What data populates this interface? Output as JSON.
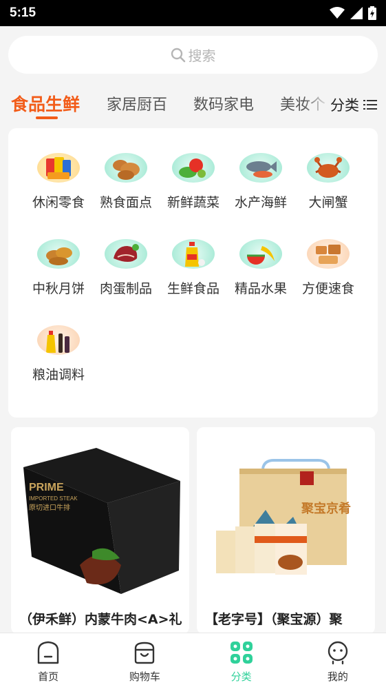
{
  "status_bar": {
    "time": "5:15"
  },
  "search": {
    "placeholder": "搜索"
  },
  "tabs": [
    {
      "label": "食品生鲜",
      "active": true
    },
    {
      "label": "家居厨百",
      "active": false
    },
    {
      "label": "数码家电",
      "active": false
    },
    {
      "label": "美妆个",
      "active": false
    }
  ],
  "category_toggle": {
    "label": "分类"
  },
  "categories": [
    {
      "label": "休闲零食",
      "icon": "snacks-icon"
    },
    {
      "label": "熟食面点",
      "icon": "bread-icon"
    },
    {
      "label": "新鲜蔬菜",
      "icon": "vegetables-icon"
    },
    {
      "label": "水产海鲜",
      "icon": "fish-icon"
    },
    {
      "label": "大闸蟹",
      "icon": "crab-icon"
    },
    {
      "label": "中秋月饼",
      "icon": "mooncake-icon"
    },
    {
      "label": "肉蛋制品",
      "icon": "meat-icon"
    },
    {
      "label": "生鲜食品",
      "icon": "oil-bottle-icon"
    },
    {
      "label": "精品水果",
      "icon": "fruit-icon"
    },
    {
      "label": "方便速食",
      "icon": "instant-food-icon"
    },
    {
      "label": "粮油调料",
      "icon": "condiments-icon"
    }
  ],
  "products": [
    {
      "title": "（伊禾鲜）内蒙牛肉<A>礼",
      "box_text": "PRIME",
      "box_subtext": "IMPORTED STEAK",
      "box_cn": "原切进口牛排"
    },
    {
      "title": "【老字号】（聚宝源）聚",
      "box_text": "聚宝京肴"
    }
  ],
  "bottom_nav": [
    {
      "label": "首页",
      "icon": "home-icon",
      "active": false
    },
    {
      "label": "购物车",
      "icon": "cart-icon",
      "active": false
    },
    {
      "label": "分类",
      "icon": "category-grid-icon",
      "active": true
    },
    {
      "label": "我的",
      "icon": "profile-icon",
      "active": false
    }
  ],
  "colors": {
    "accent": "#f25c19",
    "nav_active": "#2fd19a",
    "background": "#f4f4f4"
  }
}
